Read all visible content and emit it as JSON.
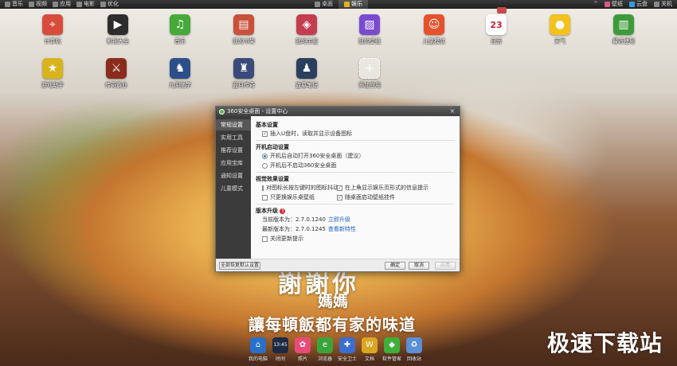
{
  "topbar": {
    "left_items": [
      "音乐",
      "视频",
      "应用",
      "电影",
      "优化"
    ],
    "tabs": [
      {
        "label": "桌面",
        "active": false
      },
      {
        "label": "娱乐",
        "active": true
      }
    ],
    "right_items": [
      "壁纸",
      "云盘",
      "关机"
    ],
    "chevron": "^"
  },
  "desktop_icons": [
    {
      "label": "计算机",
      "icon": "computer-icon",
      "glyph": "⌖",
      "color": "#d84c3c"
    },
    {
      "label": "影视大全",
      "icon": "video-icon",
      "glyph": "▶",
      "color": "#2d2d2d"
    },
    {
      "label": "音乐",
      "icon": "music-note-icon",
      "glyph": "♫",
      "color": "#46a93a"
    },
    {
      "label": "我的书架",
      "icon": "bookshelf-icon",
      "glyph": "▤",
      "color": "#c9503a"
    },
    {
      "label": "我的主题",
      "icon": "theme-icon",
      "glyph": "◈",
      "color": "#c43d4f"
    },
    {
      "label": "我的壁纸",
      "icon": "wallpaper-icon",
      "glyph": "▨",
      "color": "#7a4ad0"
    },
    {
      "label": "儿童模式",
      "icon": "kids-mode-icon",
      "glyph": "☺",
      "color": "#e6522c"
    },
    {
      "label": "日历",
      "icon": "calendar-icon",
      "glyph": "23",
      "color": "#ffffff"
    },
    {
      "label": "天气",
      "icon": "weather-icon",
      "glyph": "●",
      "color": "#f3c21c"
    },
    {
      "label": "最近使用",
      "icon": "recent-apps-icon",
      "glyph": "▥",
      "color": "#3e9b3b"
    },
    {
      "label": "游戏助手",
      "icon": "game-helper-icon",
      "glyph": "★",
      "color": "#d9b31c"
    },
    {
      "label": "传奇霸业",
      "icon": "game-legend-icon",
      "glyph": "⚔",
      "color": "#8a2c1c"
    },
    {
      "label": "九阴绝学",
      "icon": "game-nine-yin-icon",
      "glyph": "♞",
      "color": "#2c4f8a"
    },
    {
      "label": "蓝月传奇",
      "icon": "game-blue-moon-icon",
      "glyph": "♜",
      "color": "#3a4a7a"
    },
    {
      "label": "盗墓笔记",
      "icon": "game-tomb-notes-icon",
      "glyph": "♟",
      "color": "#2a3f5c"
    },
    {
      "label": "添加应用",
      "icon": "add-app-icon",
      "glyph": "+",
      "color": "rgba(255,255,255,0.35)"
    }
  ],
  "dialog": {
    "title": "360安全桌面 - 设置中心",
    "close_glyph": "×",
    "sidebar": [
      "常规设置",
      "实用工具",
      "推荐设置",
      "应用宝库",
      "通知设置",
      "儿童模式"
    ],
    "sections": {
      "basic": {
        "title": "基本设置",
        "items": [
          {
            "label": "插入U盘时，读取并显示设备图标",
            "checked": true
          }
        ]
      },
      "startup": {
        "title": "开机启动设置",
        "options": [
          {
            "label": "开机后自动打开360安全桌面（建议）",
            "selected": true
          },
          {
            "label": "开机后不启动360安全桌面",
            "selected": false
          }
        ]
      },
      "visual": {
        "title": "视觉效果设置",
        "items": [
          {
            "label": "对图标长按左键时的图标抖动",
            "checked": false
          },
          {
            "label": "在上角显示娱乐页形式的信息提示",
            "checked": true
          },
          {
            "label": "只更换娱乐桌壁纸",
            "checked": false
          },
          {
            "label": "随桌面启动壁纸挂件",
            "checked": true
          }
        ]
      },
      "version": {
        "title": "版本升级",
        "current_label": "当前版本为：2.7.0.1240",
        "upgrade_link": "立即升级",
        "latest_label": "最新版本为：2.7.0.1245",
        "features_link": "查看新特性",
        "auto_update": {
          "label": "关闭更新提示",
          "checked": false
        },
        "warning_glyph": "!"
      }
    },
    "footer": {
      "restore_label": "全部恢复默认设置",
      "ok_label": "确定",
      "cancel_label": "取消",
      "apply_label": "应用"
    }
  },
  "overlay": {
    "line1": "謝謝你",
    "line2": "媽媽",
    "line3": "讓每頓飯都有家的味道",
    "watermark": "极速下载站"
  },
  "dock": [
    {
      "label": "我的电脑",
      "icon": "my-computer-icon",
      "glyph": "⌂",
      "color": "#2a6fc9"
    },
    {
      "label": "时间",
      "icon": "clock-icon",
      "glyph": "13:45",
      "color": "#1e2a44"
    },
    {
      "label": "照片",
      "icon": "photo-icon",
      "glyph": "✿",
      "color": "#e64b7a"
    },
    {
      "label": "浏览器",
      "icon": "browser-icon",
      "glyph": "e",
      "color": "#3aa43a"
    },
    {
      "label": "安全卫士",
      "icon": "security-icon",
      "glyph": "✚",
      "color": "#3b6ed0"
    },
    {
      "label": "文档",
      "icon": "document-icon",
      "glyph": "W",
      "color": "#d9a623"
    },
    {
      "label": "软件管家",
      "icon": "software-manager-icon",
      "glyph": "◆",
      "color": "#3fae3a"
    },
    {
      "label": "回收站",
      "icon": "recycle-bin-icon",
      "glyph": "♻",
      "color": "#5b8fd6"
    }
  ]
}
